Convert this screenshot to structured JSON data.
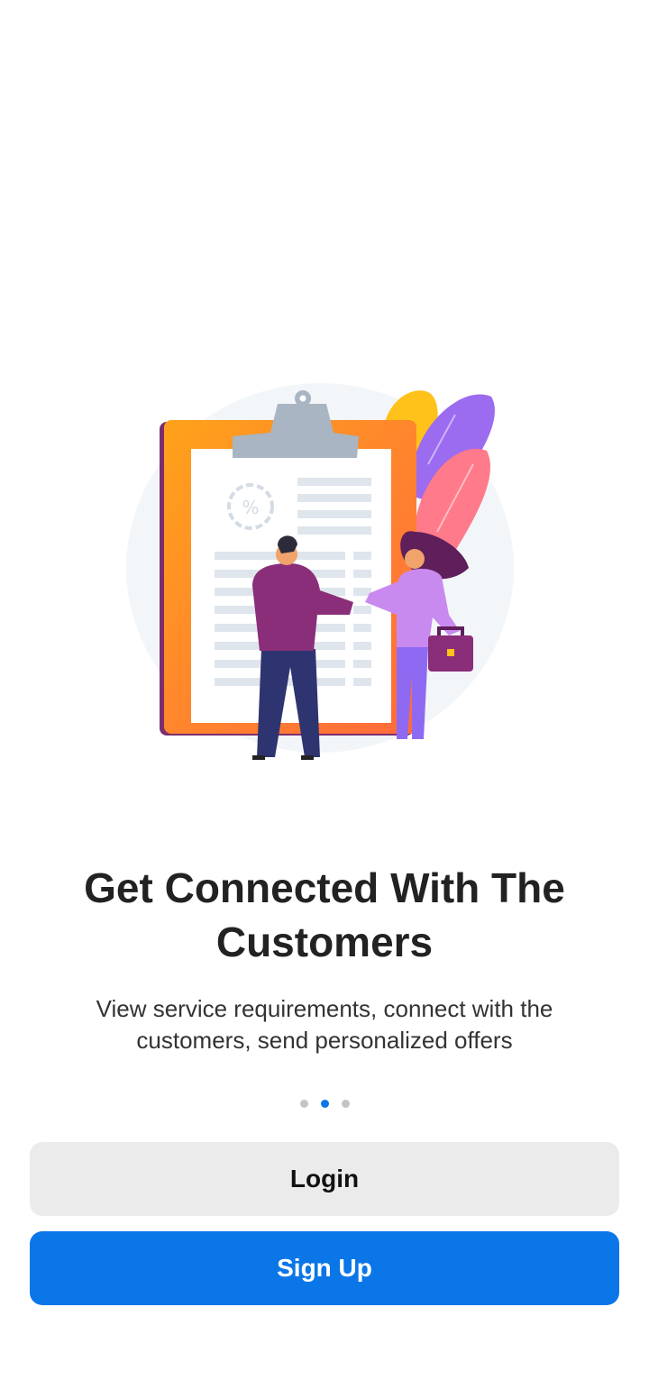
{
  "onboarding": {
    "title": "Get Connected With The Customers",
    "description": "View service requirements, connect with the customers, send personalized offers",
    "pager": {
      "page_count": 3,
      "current_page": 2,
      "active_color": "#0a76e8",
      "inactive_color": "#c4c4c4"
    }
  },
  "actions": {
    "login_label": "Login",
    "signup_label": "Sign Up"
  },
  "colors": {
    "primary": "#0a76e8",
    "secondary_button": "#ebebeb"
  },
  "illustration": {
    "icon": "clipboard-handshake-illustration"
  }
}
